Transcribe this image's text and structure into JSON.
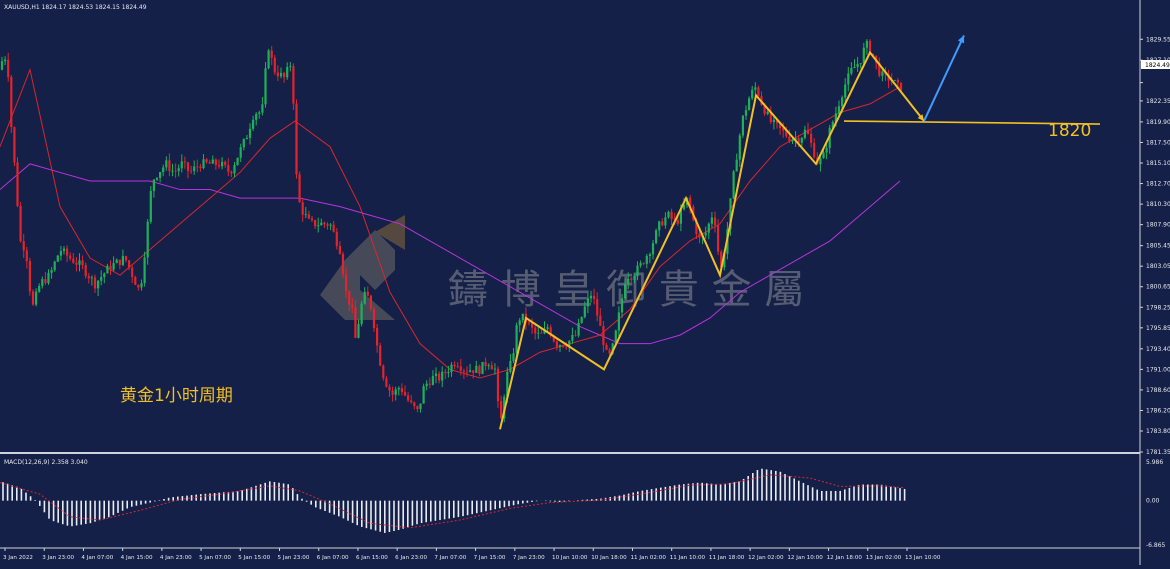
{
  "window": {
    "symbol_info": "XAUUSD,H1  1824.17 1824.53 1824.15 1824.49",
    "watermark": "鑄 博 皇 御 貴 金 屬",
    "chart_label": "黄金1小时周期",
    "level_label": "1820",
    "macd_info": "MACD(12,26,9) 2.358 3.040",
    "current_price": "1824.49"
  },
  "colors": {
    "background": "#142047",
    "bull": "#1db25a",
    "bear": "#e5232b",
    "ma_short": "#d9262e",
    "ma_long": "#b934d8",
    "wave": "#f3c022",
    "forecast_arrow": "#3e9bff",
    "level_line": "#f3c022",
    "histogram": "#e9ecf5",
    "signal": "#d9262e"
  },
  "chart_data": [
    {
      "type": "candlestick",
      "symbol": "XAUUSD",
      "timeframe": "H1",
      "ohlc_last": {
        "open": 1824.17,
        "high": 1824.53,
        "low": 1824.15,
        "close": 1824.49
      },
      "ylim": [
        1781.35,
        1831.8
      ],
      "y_ticks": [
        "1829.55",
        "1827.10",
        "1824.49",
        "1822.35",
        "1819.90",
        "1817.50",
        "1815.10",
        "1812.70",
        "1810.30",
        "1807.90",
        "1805.45",
        "1803.05",
        "1800.65",
        "1798.25",
        "1795.85",
        "1793.40",
        "1791.00",
        "1788.60",
        "1786.20",
        "1783.80",
        "1781.35"
      ],
      "x_labels": [
        "3 Jan 2022",
        "3 Jan 23:00",
        "4 Jan 07:00",
        "4 Jan 15:00",
        "4 Jan 23:00",
        "5 Jan 07:00",
        "5 Jan 15:00",
        "5 Jan 23:00",
        "6 Jan 07:00",
        "6 Jan 15:00",
        "6 Jan 23:00",
        "7 Jan 07:00",
        "7 Jan 15:00",
        "7 Jan 23:00",
        "10 Jan 10:00",
        "10 Jan 18:00",
        "11 Jan 02:00",
        "11 Jan 10:00",
        "11 Jan 18:00",
        "12 Jan 02:00",
        "12 Jan 10:00",
        "12 Jan 18:00",
        "13 Jan 02:00",
        "13 Jan 10:00"
      ],
      "anchors": [
        [
          0,
          1826
        ],
        [
          4,
          1828
        ],
        [
          8,
          1826
        ],
        [
          12,
          1818
        ],
        [
          16,
          1813
        ],
        [
          20,
          1806
        ],
        [
          26,
          1805
        ],
        [
          32,
          1798
        ],
        [
          40,
          1801
        ],
        [
          50,
          1802
        ],
        [
          60,
          1805
        ],
        [
          70,
          1804
        ],
        [
          82,
          1803
        ],
        [
          95,
          1801
        ],
        [
          110,
          1803
        ],
        [
          125,
          1804
        ],
        [
          140,
          1800
        ],
        [
          146,
          1806
        ],
        [
          152,
          1813
        ],
        [
          158,
          1814
        ],
        [
          166,
          1815
        ],
        [
          174,
          1814
        ],
        [
          182,
          1815
        ],
        [
          190,
          1814
        ],
        [
          200,
          1815
        ],
        [
          210,
          1815
        ],
        [
          220,
          1815
        ],
        [
          230,
          1814
        ],
        [
          238,
          1816
        ],
        [
          246,
          1818
        ],
        [
          254,
          1821
        ],
        [
          262,
          1821
        ],
        [
          268,
          1829
        ],
        [
          274,
          1826
        ],
        [
          284,
          1825
        ],
        [
          292,
          1827
        ],
        [
          296,
          1814
        ],
        [
          300,
          1810
        ],
        [
          310,
          1808
        ],
        [
          320,
          1808
        ],
        [
          330,
          1808
        ],
        [
          340,
          1805
        ],
        [
          346,
          1800
        ],
        [
          352,
          1798
        ],
        [
          356,
          1794
        ],
        [
          360,
          1798
        ],
        [
          366,
          1800
        ],
        [
          372,
          1798
        ],
        [
          378,
          1793
        ],
        [
          384,
          1790
        ],
        [
          392,
          1788
        ],
        [
          400,
          1789
        ],
        [
          410,
          1787
        ],
        [
          418,
          1786
        ],
        [
          424,
          1789
        ],
        [
          432,
          1790
        ],
        [
          440,
          1790
        ],
        [
          448,
          1791
        ],
        [
          456,
          1792
        ],
        [
          464,
          1791
        ],
        [
          472,
          1791
        ],
        [
          480,
          1791
        ],
        [
          488,
          1792
        ],
        [
          495,
          1791
        ],
        [
          500,
          1784
        ],
        [
          506,
          1790
        ],
        [
          512,
          1792
        ],
        [
          518,
          1797
        ],
        [
          524,
          1797
        ],
        [
          530,
          1796
        ],
        [
          536,
          1795
        ],
        [
          542,
          1795
        ],
        [
          548,
          1796
        ],
        [
          556,
          1794
        ],
        [
          566,
          1794
        ],
        [
          576,
          1795
        ],
        [
          584,
          1798
        ],
        [
          592,
          1800
        ],
        [
          598,
          1797
        ],
        [
          604,
          1794
        ],
        [
          608,
          1792
        ],
        [
          614,
          1794
        ],
        [
          620,
          1798
        ],
        [
          626,
          1802
        ],
        [
          632,
          1802
        ],
        [
          640,
          1803
        ],
        [
          650,
          1805
        ],
        [
          660,
          1808
        ],
        [
          668,
          1809
        ],
        [
          676,
          1808
        ],
        [
          684,
          1810
        ],
        [
          688,
          1811
        ],
        [
          694,
          1808
        ],
        [
          700,
          1806
        ],
        [
          706,
          1807
        ],
        [
          712,
          1809
        ],
        [
          716,
          1808
        ],
        [
          720,
          1802
        ],
        [
          726,
          1806
        ],
        [
          734,
          1814
        ],
        [
          742,
          1820
        ],
        [
          750,
          1823
        ],
        [
          756,
          1824
        ],
        [
          762,
          1822
        ],
        [
          770,
          1820
        ],
        [
          780,
          1819
        ],
        [
          790,
          1818
        ],
        [
          800,
          1818
        ],
        [
          806,
          1819
        ],
        [
          812,
          1817
        ],
        [
          818,
          1815
        ],
        [
          824,
          1816
        ],
        [
          830,
          1819
        ],
        [
          836,
          1821
        ],
        [
          844,
          1824
        ],
        [
          852,
          1826
        ],
        [
          860,
          1827
        ],
        [
          866,
          1829
        ],
        [
          872,
          1828
        ],
        [
          878,
          1826
        ],
        [
          884,
          1825
        ],
        [
          890,
          1825
        ],
        [
          898,
          1824
        ],
        [
          904,
          1824
        ]
      ],
      "ma_short": [
        [
          0,
          1817
        ],
        [
          30,
          1826
        ],
        [
          60,
          1810
        ],
        [
          90,
          1804
        ],
        [
          120,
          1802
        ],
        [
          150,
          1805
        ],
        [
          180,
          1808
        ],
        [
          210,
          1811
        ],
        [
          240,
          1814
        ],
        [
          270,
          1818
        ],
        [
          295,
          1820
        ],
        [
          330,
          1817
        ],
        [
          360,
          1810
        ],
        [
          390,
          1800
        ],
        [
          420,
          1794
        ],
        [
          450,
          1791
        ],
        [
          480,
          1790
        ],
        [
          510,
          1791
        ],
        [
          540,
          1793
        ],
        [
          570,
          1794
        ],
        [
          600,
          1795
        ],
        [
          630,
          1798
        ],
        [
          660,
          1803
        ],
        [
          690,
          1806
        ],
        [
          720,
          1808
        ],
        [
          750,
          1813
        ],
        [
          780,
          1817
        ],
        [
          810,
          1819
        ],
        [
          840,
          1821
        ],
        [
          870,
          1822
        ],
        [
          900,
          1824
        ]
      ],
      "ma_long": [
        [
          0,
          1812
        ],
        [
          30,
          1815
        ],
        [
          60,
          1814
        ],
        [
          90,
          1813
        ],
        [
          120,
          1813
        ],
        [
          150,
          1813
        ],
        [
          180,
          1812
        ],
        [
          210,
          1812
        ],
        [
          240,
          1811
        ],
        [
          270,
          1811
        ],
        [
          300,
          1811
        ],
        [
          340,
          1810
        ],
        [
          370,
          1809
        ],
        [
          400,
          1808
        ],
        [
          430,
          1806
        ],
        [
          460,
          1804
        ],
        [
          490,
          1802
        ],
        [
          520,
          1800
        ],
        [
          550,
          1798
        ],
        [
          580,
          1796
        ],
        [
          600,
          1795
        ],
        [
          620,
          1794
        ],
        [
          650,
          1794
        ],
        [
          680,
          1795
        ],
        [
          710,
          1797
        ],
        [
          740,
          1800
        ],
        [
          770,
          1802
        ],
        [
          800,
          1804
        ],
        [
          830,
          1806
        ],
        [
          860,
          1809
        ],
        [
          880,
          1811
        ],
        [
          900,
          1813
        ]
      ],
      "wave": [
        [
          500,
          1784
        ],
        [
          526,
          1797
        ],
        [
          604,
          1791
        ],
        [
          686,
          1811
        ],
        [
          720,
          1802
        ],
        [
          756,
          1823
        ],
        [
          816,
          1815
        ],
        [
          870,
          1828
        ],
        [
          924,
          1820
        ]
      ],
      "forecast_arrow": {
        "from": [
          924,
          1820
        ],
        "to": [
          964,
          1830
        ]
      },
      "level_line": {
        "value": 1820,
        "x_from": 844,
        "x_to": 1100
      }
    },
    {
      "type": "histogram",
      "name": "MACD(12,26,9)",
      "values_shown": {
        "macd": 2.358,
        "signal": 3.04
      },
      "ylim": [
        -6.865,
        5.986
      ],
      "y_ticks": [
        "5.986",
        "0.00",
        "-6.865"
      ],
      "hist_anchors": [
        [
          0,
          3.0
        ],
        [
          20,
          2.0
        ],
        [
          36,
          0.0
        ],
        [
          50,
          -3.0
        ],
        [
          70,
          -4.0
        ],
        [
          90,
          -3.5
        ],
        [
          110,
          -2.5
        ],
        [
          130,
          -1.0
        ],
        [
          150,
          -0.3
        ],
        [
          170,
          0.5
        ],
        [
          200,
          1.0
        ],
        [
          240,
          1.5
        ],
        [
          270,
          3.0
        ],
        [
          290,
          2.5
        ],
        [
          300,
          0.5
        ],
        [
          315,
          -1.0
        ],
        [
          340,
          -2.5
        ],
        [
          360,
          -4.0
        ],
        [
          385,
          -5.0
        ],
        [
          400,
          -4.5
        ],
        [
          420,
          -3.5
        ],
        [
          460,
          -2.5
        ],
        [
          490,
          -1.5
        ],
        [
          520,
          -0.5
        ],
        [
          540,
          0.0
        ],
        [
          560,
          -0.2
        ],
        [
          580,
          0.1
        ],
        [
          600,
          0.3
        ],
        [
          620,
          0.8
        ],
        [
          640,
          1.5
        ],
        [
          660,
          2.0
        ],
        [
          680,
          2.5
        ],
        [
          700,
          2.8
        ],
        [
          720,
          2.5
        ],
        [
          740,
          3.0
        ],
        [
          760,
          5.0
        ],
        [
          780,
          4.5
        ],
        [
          800,
          3.0
        ],
        [
          820,
          1.5
        ],
        [
          840,
          1.5
        ],
        [
          860,
          2.5
        ],
        [
          880,
          2.5
        ],
        [
          905,
          1.8
        ]
      ],
      "signal_anchors": [
        [
          0,
          2.8
        ],
        [
          40,
          1.0
        ],
        [
          70,
          -2.5
        ],
        [
          100,
          -3.0
        ],
        [
          140,
          -1.5
        ],
        [
          180,
          0.2
        ],
        [
          220,
          1.0
        ],
        [
          270,
          2.3
        ],
        [
          300,
          1.5
        ],
        [
          330,
          -0.5
        ],
        [
          370,
          -3.5
        ],
        [
          410,
          -4.2
        ],
        [
          460,
          -3.0
        ],
        [
          510,
          -1.2
        ],
        [
          550,
          -0.3
        ],
        [
          600,
          0.1
        ],
        [
          640,
          1.0
        ],
        [
          690,
          2.4
        ],
        [
          730,
          2.6
        ],
        [
          770,
          4.0
        ],
        [
          810,
          3.5
        ],
        [
          840,
          2.2
        ],
        [
          880,
          2.3
        ],
        [
          905,
          2.0
        ]
      ]
    }
  ]
}
